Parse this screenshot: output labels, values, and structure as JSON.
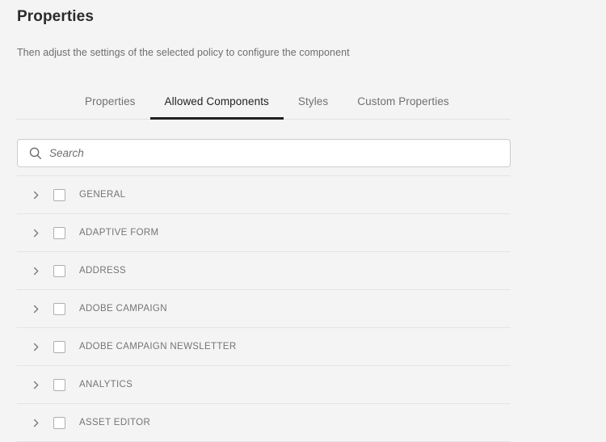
{
  "header": {
    "title": "Properties",
    "subtitle": "Then adjust the settings of the selected policy to configure the component"
  },
  "tabs": [
    {
      "label": "Properties",
      "active": false
    },
    {
      "label": "Allowed Components",
      "active": true
    },
    {
      "label": "Styles",
      "active": false
    },
    {
      "label": "Custom Properties",
      "active": false
    }
  ],
  "search": {
    "placeholder": "Search",
    "value": "",
    "icon": "search-icon"
  },
  "components": {
    "rows": [
      {
        "label": "GENERAL",
        "checked": false,
        "expanded": false
      },
      {
        "label": "ADAPTIVE FORM",
        "checked": false,
        "expanded": false
      },
      {
        "label": "ADDRESS",
        "checked": false,
        "expanded": false
      },
      {
        "label": "ADOBE CAMPAIGN",
        "checked": false,
        "expanded": false
      },
      {
        "label": "ADOBE CAMPAIGN NEWSLETTER",
        "checked": false,
        "expanded": false
      },
      {
        "label": "ANALYTICS",
        "checked": false,
        "expanded": false
      },
      {
        "label": "ASSET EDITOR",
        "checked": false,
        "expanded": false
      }
    ],
    "row_icons": {
      "expand": "chevron-right-icon",
      "select": "checkbox"
    }
  },
  "colors": {
    "background": "#f4f4f4",
    "active_tab_indicator": "#1f1f1f",
    "text_primary": "#2b2b2b",
    "text_muted": "#707070",
    "divider": "#e4e4e4",
    "field_border": "#cdcdcd",
    "field_background": "#ffffff"
  }
}
